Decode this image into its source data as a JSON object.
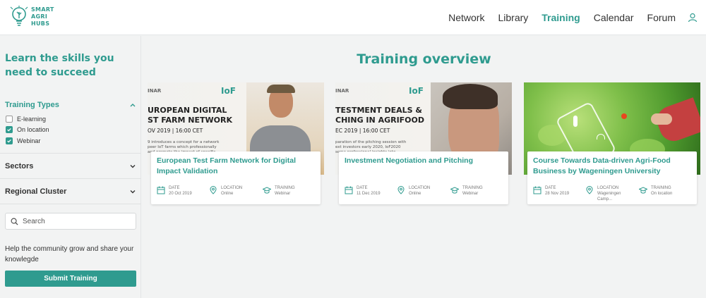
{
  "header": {
    "logo_line1": "SMART",
    "logo_line2": "AGRI",
    "logo_line3": "HUBS",
    "nav": [
      {
        "label": "Network",
        "active": false
      },
      {
        "label": "Library",
        "active": false
      },
      {
        "label": "Training",
        "active": true
      },
      {
        "label": "Calendar",
        "active": false
      },
      {
        "label": "Forum",
        "active": false
      }
    ],
    "user_icon": "user-icon"
  },
  "sidebar": {
    "title": "Learn the skills you need to succeed",
    "training_types": {
      "label": "Training Types",
      "expanded": true,
      "options": [
        {
          "label": "E-learning",
          "checked": false
        },
        {
          "label": "On location",
          "checked": true
        },
        {
          "label": "Webinar",
          "checked": true
        }
      ]
    },
    "sectors_label": "Sectors",
    "regional_label": "Regional Cluster",
    "search_placeholder": "Search",
    "help_text": "Help the community grow and share your knowlegde",
    "submit_label": "Submit Training"
  },
  "main": {
    "title": "Training overview",
    "cards": [
      {
        "title": "European Test Farm Network for Digital Impact Validation",
        "date_label": "DATE",
        "date": "20 Oct 2019",
        "location_label": "LOCATION",
        "location": "Online",
        "training_label": "TRAINING",
        "training": "Webinar",
        "image_text": {
          "tag": "INAR",
          "line1": "UROPEAN DIGITAL",
          "line2": "ST FARM NETWORK",
          "date": "OV 2019 | 16:00 CET",
          "small1": "9 introduces a concept for a network",
          "small2": "peer IoT farms which professionally",
          "small3": "and promote the impact of specific",
          "logo": "IoF"
        }
      },
      {
        "title": "Investment Negotiation and Pitching",
        "date_label": "DATE",
        "date": "11 Dec 2019",
        "location_label": "LOCATION",
        "location": "Online",
        "training_label": "TRAINING",
        "training": "Webinar",
        "image_text": {
          "tag": "INAR",
          "line1": "TESTMENT DEALS &",
          "line2": "CHING IN AGRIFOOD",
          "date": "EC 2019 | 16:00 CET",
          "small1": "paration of the pitching session with",
          "small2": "ext investors early 2020, IoF2020",
          "small3": "some professional insights into",
          "logo": "IoF"
        }
      },
      {
        "title": "Course Towards Data-driven Agri-Food Business by Wageningen University",
        "date_label": "DATE",
        "date": "28 Nov 2019",
        "location_label": "LOCATION",
        "location": "Wageningen Camp...",
        "training_label": "TRAINING",
        "training": "On location"
      }
    ]
  },
  "colors": {
    "accent": "#2f9b8f",
    "background": "#f2f3f3"
  }
}
